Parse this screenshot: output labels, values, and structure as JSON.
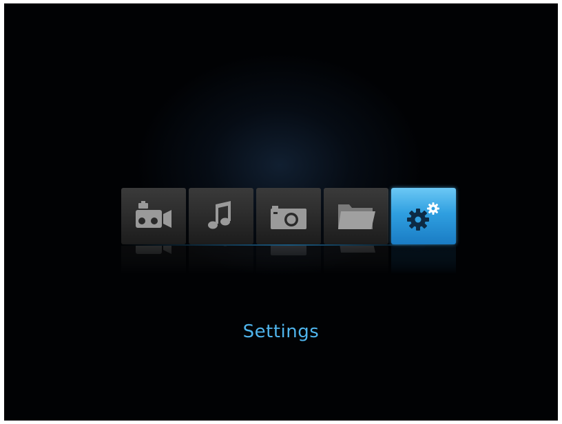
{
  "menu": {
    "items": [
      {
        "id": "video",
        "icon": "video-camera-icon"
      },
      {
        "id": "music",
        "icon": "music-note-icon"
      },
      {
        "id": "photo",
        "icon": "camera-icon"
      },
      {
        "id": "files",
        "icon": "folder-icon"
      },
      {
        "id": "settings",
        "icon": "gears-icon"
      }
    ],
    "selected": "settings",
    "selected_label": "Settings"
  },
  "colors": {
    "background": "#010204",
    "tile": "#2e2e2e",
    "tile_active": "#2f9fe0",
    "icon": "#9a9a9a",
    "label": "#4fb4ec"
  }
}
